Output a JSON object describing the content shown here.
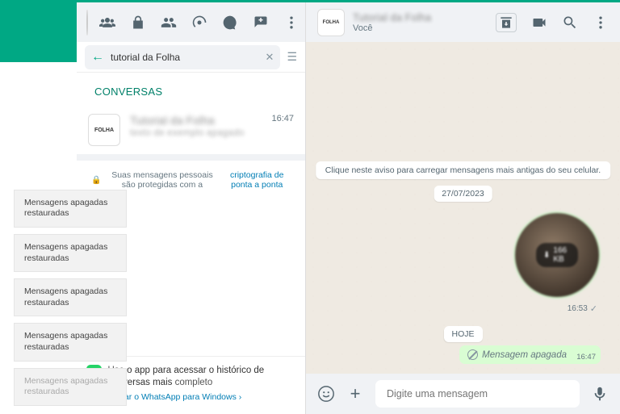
{
  "search": {
    "value": "tutorial da Folha",
    "placeholder": ""
  },
  "section_label": "CONVERSAS",
  "chat": {
    "avatar_label": "FOLHA",
    "title": "Tutorial da Folha",
    "subtitle": "texto de exemplo apagado",
    "time": "16:47"
  },
  "encryption": {
    "prefix": "Suas mensagens pessoais são protegidas com a ",
    "link": "criptografia de ponta a ponta"
  },
  "promo": {
    "line1a": "Use ",
    "line1b": "o app para acessar o histórico de conversas mais",
    "line1c": " completo",
    "sub_prefix": "Baixar ",
    "sub_link": "o WhatsApp para Windows",
    "sub_arrow": " ›"
  },
  "conversation": {
    "avatar_label": "FOLHA",
    "title": "Tutorial da Folha",
    "subtitle": "Você",
    "notice": "Clique neste aviso para carregar mensagens mais antigas do seu celular.",
    "date1": "27/07/2023",
    "date2": "HOJE",
    "media_size": "166 KB",
    "media_time": "16:53",
    "deleted_label": "Mensagem apagada",
    "deleted_time": "16:47"
  },
  "composer": {
    "placeholder": "Digite uma mensagem"
  },
  "toast_label": "Mensagens apagadas restauradas"
}
